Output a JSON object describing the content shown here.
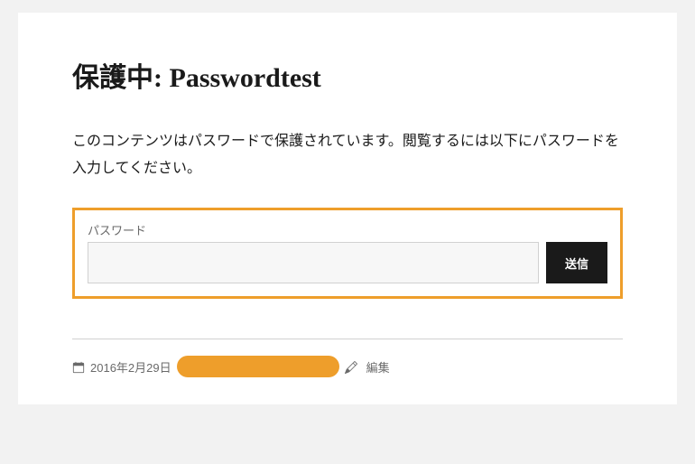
{
  "post": {
    "title": "保護中: Passwordtest",
    "message": "このコンテンツはパスワードで保護されています。閲覧するには以下にパスワードを入力してください。",
    "password_form": {
      "label": "パスワード",
      "value": "",
      "submit": "送信"
    },
    "meta": {
      "date": "2016年2月29日",
      "edit": "編集"
    }
  }
}
